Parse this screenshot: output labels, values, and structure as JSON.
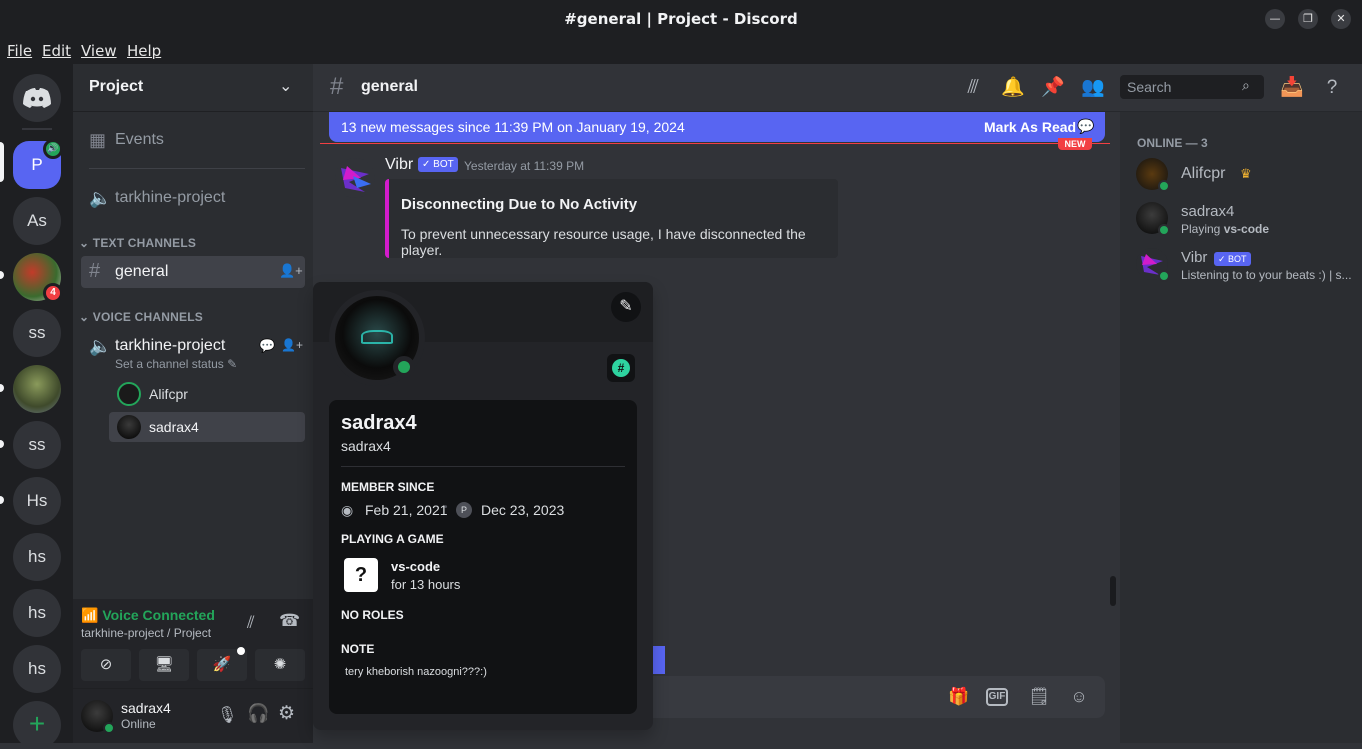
{
  "window": {
    "title": "#general | Project - Discord"
  },
  "menu": {
    "file": "File",
    "edit": "Edit",
    "view": "View",
    "help": "Help"
  },
  "rail": {
    "servers": [
      {
        "label": "P",
        "badge": ""
      },
      {
        "label": "As"
      },
      {
        "label": "",
        "badge": "4"
      },
      {
        "label": "ss"
      },
      {
        "label": ""
      },
      {
        "label": "ss"
      },
      {
        "label": "Hs"
      },
      {
        "label": "hs"
      },
      {
        "label": "hs"
      },
      {
        "label": "hs"
      }
    ],
    "add": "+"
  },
  "sidebar": {
    "server_name": "Project",
    "events": "Events",
    "voice_top": "tarkhine-project",
    "text_category": "TEXT CHANNELS",
    "general": "general",
    "voice_category": "VOICE CHANNELS",
    "voice_channel": "tarkhine-project",
    "channel_status": "Set a channel status",
    "voice_users": [
      "Alifcpr",
      "sadrax4"
    ]
  },
  "voice": {
    "status": "Voice Connected",
    "location": "tarkhine-project / Project"
  },
  "user": {
    "name": "sadrax4",
    "status": "Online"
  },
  "chat": {
    "channel": "general",
    "search_placeholder": "Search",
    "banner_text": "13 new messages since 11:39 PM on January 19, 2024",
    "mark_read": "Mark As Read",
    "new_tag": "NEW",
    "message": {
      "author": "Vibr",
      "bot_tag": "BOT",
      "time": "Yesterday at 11:39 PM",
      "embed_title": "Disconnecting Due to No Activity",
      "embed_desc": "To prevent unnecessary resource usage, I have disconnected the player."
    }
  },
  "members": {
    "heading": "ONLINE — 3",
    "list": [
      {
        "name": "Alifcpr",
        "activity": ""
      },
      {
        "name": "sadrax4",
        "activity_prefix": "Playing ",
        "activity_bold": "vs-code"
      },
      {
        "name": "Vibr",
        "bot": "BOT",
        "activity": "Listening to to your beats :) | s..."
      }
    ]
  },
  "profile": {
    "display_name": "sadrax4",
    "username": "sadrax4",
    "member_since_label": "MEMBER SINCE",
    "discord_since": "Feb 21, 2021",
    "server_since": "Dec 23, 2023",
    "server_initial": "P",
    "playing_label": "PLAYING A GAME",
    "game": "vs-code",
    "game_time": "for 13 hours",
    "roles_label": "NO ROLES",
    "note_label": "NOTE",
    "note": "tery kheborish nazoogni???:)"
  },
  "composer": {
    "gif": "GIF"
  },
  "colors": {
    "accent": "#5865f2",
    "online": "#23a55a",
    "danger": "#f23f43",
    "embed_bar": "#d21ccb"
  }
}
